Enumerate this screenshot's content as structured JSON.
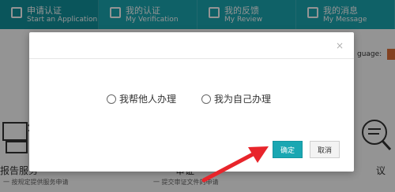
{
  "nav": {
    "items": [
      {
        "cn": "申请认证",
        "en": "Start an Application",
        "icon": "application-icon"
      },
      {
        "cn": "我的认证",
        "en": "My Verification",
        "icon": "verification-icon"
      },
      {
        "cn": "我的反馈",
        "en": "My Review",
        "icon": "review-icon"
      },
      {
        "cn": "我的消息",
        "en": "My Message",
        "icon": "message-icon"
      }
    ]
  },
  "language_label": "guage:",
  "background": {
    "left_title": "报告服务",
    "left_sub": "一 按规定提供服务申请",
    "mid_title": "审证",
    "mid_sub": "一 提交审证文件的申请",
    "right_title": "议"
  },
  "modal": {
    "close": "×",
    "options": [
      "我帮他人办理",
      "我为自己办理"
    ],
    "ok_label": "确定",
    "cancel_label": "取消"
  },
  "colors": {
    "accent": "#1aa7b2",
    "arrow": "#e8252b"
  }
}
